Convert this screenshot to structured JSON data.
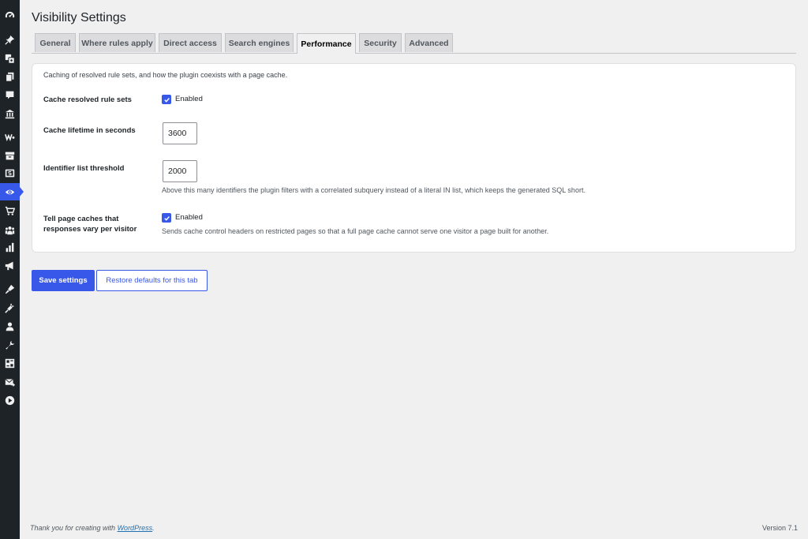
{
  "admin_menu": {
    "icons": [
      "dashboard-icon",
      "pin-icon",
      "media-icon",
      "pages-icon",
      "comments-icon",
      "bank-icon",
      "woo-icon",
      "archive-icon",
      "money-icon",
      "visibility-icon",
      "cart-icon",
      "groups-icon",
      "analytics-icon",
      "megaphone-icon",
      "appearance-icon",
      "plugins-icon",
      "users-icon",
      "tools-icon",
      "settings-icon",
      "mail-icon",
      "play-icon"
    ],
    "current": "visibility-icon",
    "accent_color": "#3858e9",
    "background_color": "#1d2327"
  },
  "page": {
    "title": "Visibility Settings"
  },
  "tabs": [
    {
      "label": "General"
    },
    {
      "label": "Where rules apply"
    },
    {
      "label": "Direct access"
    },
    {
      "label": "Search engines"
    },
    {
      "label": "Performance",
      "active": true
    },
    {
      "label": "Security"
    },
    {
      "label": "Advanced"
    }
  ],
  "panel": {
    "intro": "Caching of resolved rule sets, and how the plugin coexists with a page cache.",
    "cache_resolved": {
      "label": "Cache resolved rule sets",
      "checked": true,
      "checkbox_label": "Enabled"
    },
    "cache_lifetime": {
      "label": "Cache lifetime in seconds",
      "value": "3600"
    },
    "identifier_threshold": {
      "label": "Identifier list threshold",
      "value": "2000",
      "description": "Above this many identifiers the plugin filters with a correlated subquery instead of a literal IN list, which keeps the generated SQL short."
    },
    "vary_per_visitor": {
      "label": "Tell page caches that responses vary per visitor",
      "checked": true,
      "checkbox_label": "Enabled",
      "description": "Sends cache control headers on restricted pages so that a full page cache cannot serve one visitor a page built for another."
    }
  },
  "buttons": {
    "save": "Save settings",
    "restore": "Restore defaults for this tab"
  },
  "footer": {
    "thanks_prefix": "Thank you for creating with ",
    "thanks_link": "WordPress",
    "thanks_suffix": ".",
    "version": "Version 7.1"
  }
}
